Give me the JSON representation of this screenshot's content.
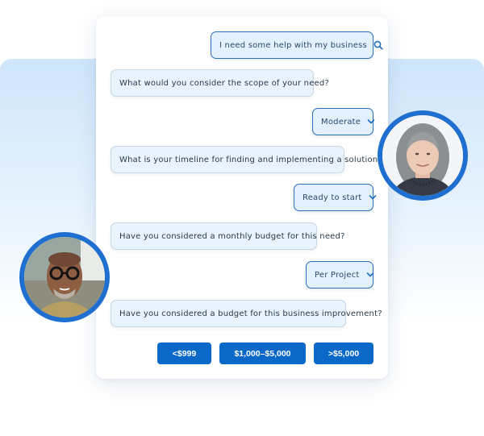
{
  "chat": {
    "user_query": "I need some help with my business",
    "q1": "What would you consider the scope of your need?",
    "a1": "Moderate",
    "q2": "What is your timeline for finding and implementing  a solution?",
    "a2": "Ready to start",
    "q3": "Have you considered a monthly budget for this need?",
    "a3": "Per Project",
    "q4": "Have you considered a budget for this business improvement?"
  },
  "budget_options": [
    "<$999",
    "$1,000–$5,000",
    ">$5,000"
  ],
  "icons": {
    "search": "search-icon",
    "dropdown": "chevron-down-icon"
  },
  "colors": {
    "accent": "#0a68c9",
    "answer_border": "#2b6fb8",
    "bubble_bg": "#e8f3fd",
    "background_band": "#cfe6fb"
  }
}
